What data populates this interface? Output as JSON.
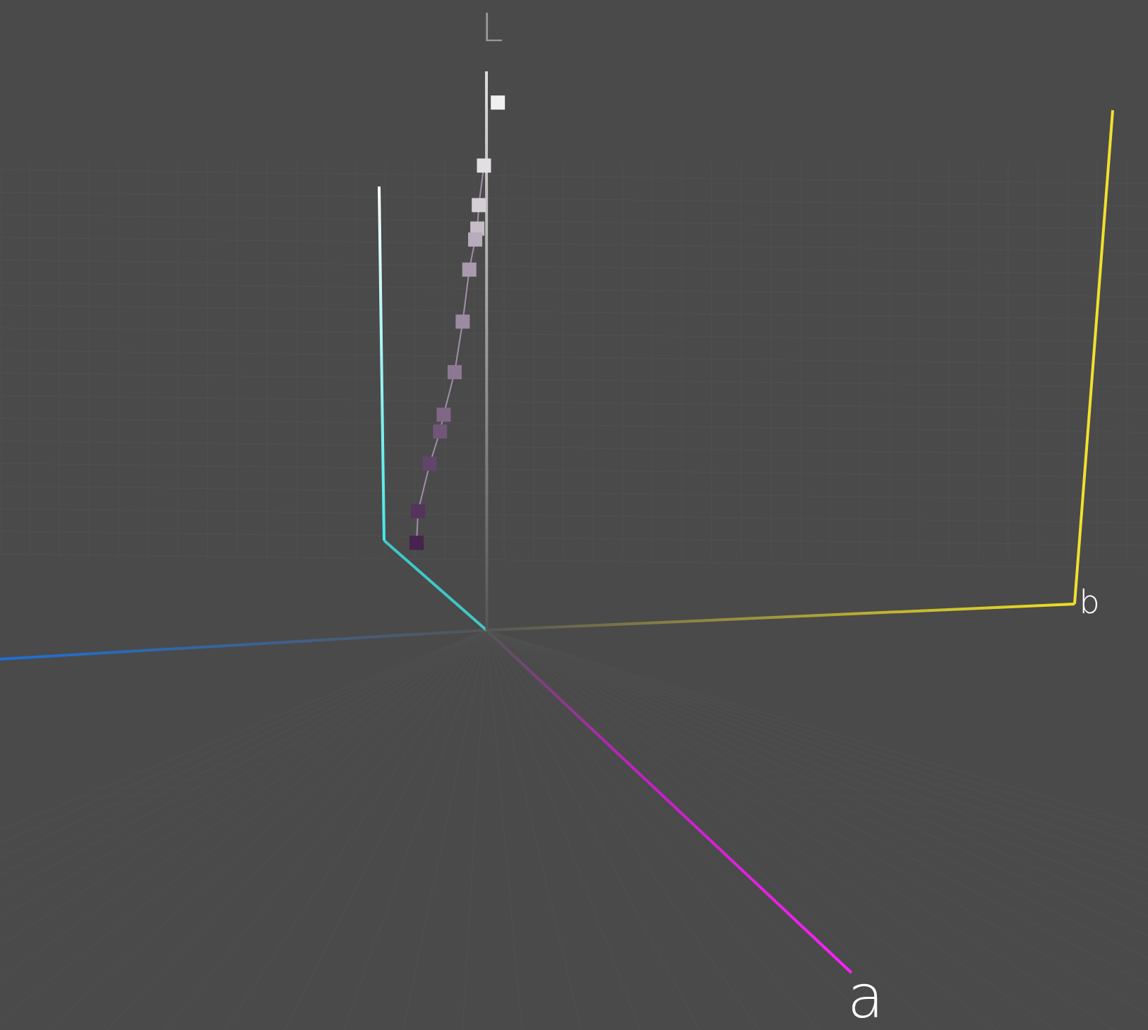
{
  "axis_labels": [
    {
      "kind": "l",
      "text": "L"
    },
    {
      "kind": "b",
      "text": "b"
    },
    {
      "kind": "a",
      "text": "a"
    }
  ]
}
